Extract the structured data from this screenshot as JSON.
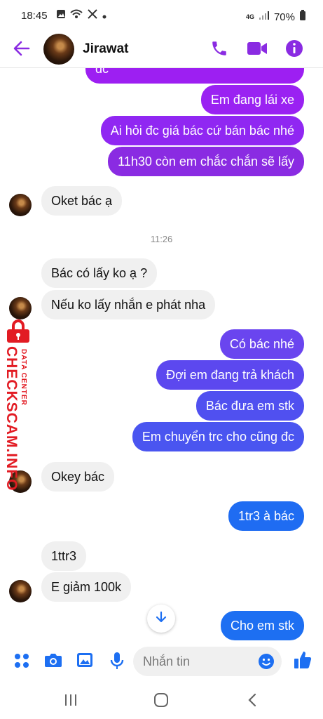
{
  "status_bar": {
    "time": "18:45",
    "network": "4G",
    "battery": "70%"
  },
  "header": {
    "contact_name": "Jirawat"
  },
  "colors": {
    "accent": "#8a2be2",
    "bubble_purple": "#9d1ff2",
    "bubble_violet": "#6b3ff0",
    "bubble_indigo": "#4b4ff0",
    "bubble_blue": "#1d6ff2",
    "incoming": "#f0f0f0"
  },
  "messages": [
    {
      "dir": "out",
      "text": "đc"
    },
    {
      "dir": "out",
      "text": "Em đang lái xe"
    },
    {
      "dir": "out",
      "text": "Ai hỏi đc giá bác cứ bán bác nhé"
    },
    {
      "dir": "out",
      "text": "11h30 còn em chắc chắn sẽ lấy"
    },
    {
      "dir": "in",
      "text": "Oket bác ạ"
    },
    {
      "dir": "in",
      "text": "Bác có lấy ko ạ ?"
    },
    {
      "dir": "in",
      "text": "Nếu ko lấy nhắn e phát nha"
    },
    {
      "dir": "out",
      "text": "Có bác nhé"
    },
    {
      "dir": "out",
      "text": "Đợi em đang trả khách"
    },
    {
      "dir": "out",
      "text": "Bác đưa em stk"
    },
    {
      "dir": "out",
      "text": "Em chuyển trc cho cũng đc"
    },
    {
      "dir": "in",
      "text": "Okey bác"
    },
    {
      "dir": "out",
      "text": "1tr3 à bác"
    },
    {
      "dir": "in",
      "text": "1ttr3"
    },
    {
      "dir": "in",
      "text": "E giảm 100k"
    },
    {
      "dir": "out",
      "text": "Cho em stk"
    }
  ],
  "timestamp": "11:26",
  "watermark": {
    "main": "CHECKSCAM.INFO",
    "sub": "DATA CENTER"
  },
  "composer": {
    "placeholder": "Nhắn tin"
  }
}
